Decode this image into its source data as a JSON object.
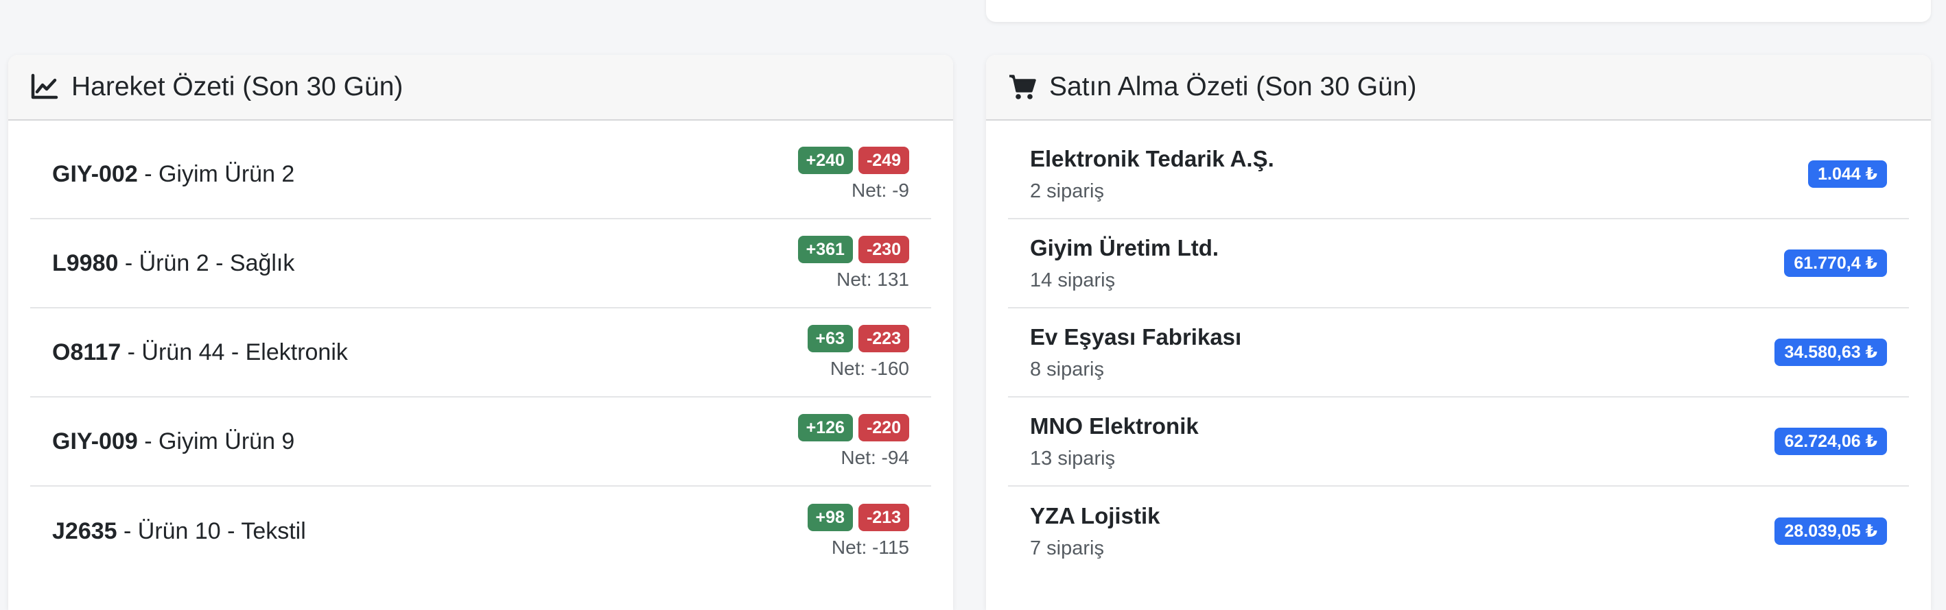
{
  "movement_summary": {
    "title": "Hareket Özeti (Son 30 Gün)",
    "icon": "chart-line-icon",
    "items": [
      {
        "code": "GIY-002",
        "name": " - Giyim Ürün 2",
        "in": "+240",
        "out": "-249",
        "net": "Net: -9"
      },
      {
        "code": "L9980",
        "name": " - Ürün 2 - Sağlık",
        "in": "+361",
        "out": "-230",
        "net": "Net: 131"
      },
      {
        "code": "O8117",
        "name": " - Ürün 44 - Elektronik",
        "in": "+63",
        "out": "-223",
        "net": "Net: -160"
      },
      {
        "code": "GIY-009",
        "name": " - Giyim Ürün 9",
        "in": "+126",
        "out": "-220",
        "net": "Net: -94"
      },
      {
        "code": "J2635",
        "name": " - Ürün 10 - Tekstil",
        "in": "+98",
        "out": "-213",
        "net": "Net: -115"
      }
    ]
  },
  "purchase_summary": {
    "title": "Satın Alma Özeti (Son 30 Gün)",
    "icon": "shopping-cart-icon",
    "items": [
      {
        "supplier": "Elektronik Tedarik A.Ş.",
        "orders": "2 sipariş",
        "amount": "1.044 ₺"
      },
      {
        "supplier": "Giyim Üretim Ltd.",
        "orders": "14 sipariş",
        "amount": "61.770,4 ₺"
      },
      {
        "supplier": "Ev Eşyası Fabrikası",
        "orders": "8 sipariş",
        "amount": "34.580,63 ₺"
      },
      {
        "supplier": "MNO Elektronik",
        "orders": "13 sipariş",
        "amount": "62.724,06 ₺"
      },
      {
        "supplier": "YZA Lojistik",
        "orders": "7 sipariş",
        "amount": "28.039,05 ₺"
      }
    ]
  },
  "colors": {
    "incoming": "#3d8a5a",
    "outgoing": "#cc4148",
    "amount": "#2d6ff2"
  }
}
